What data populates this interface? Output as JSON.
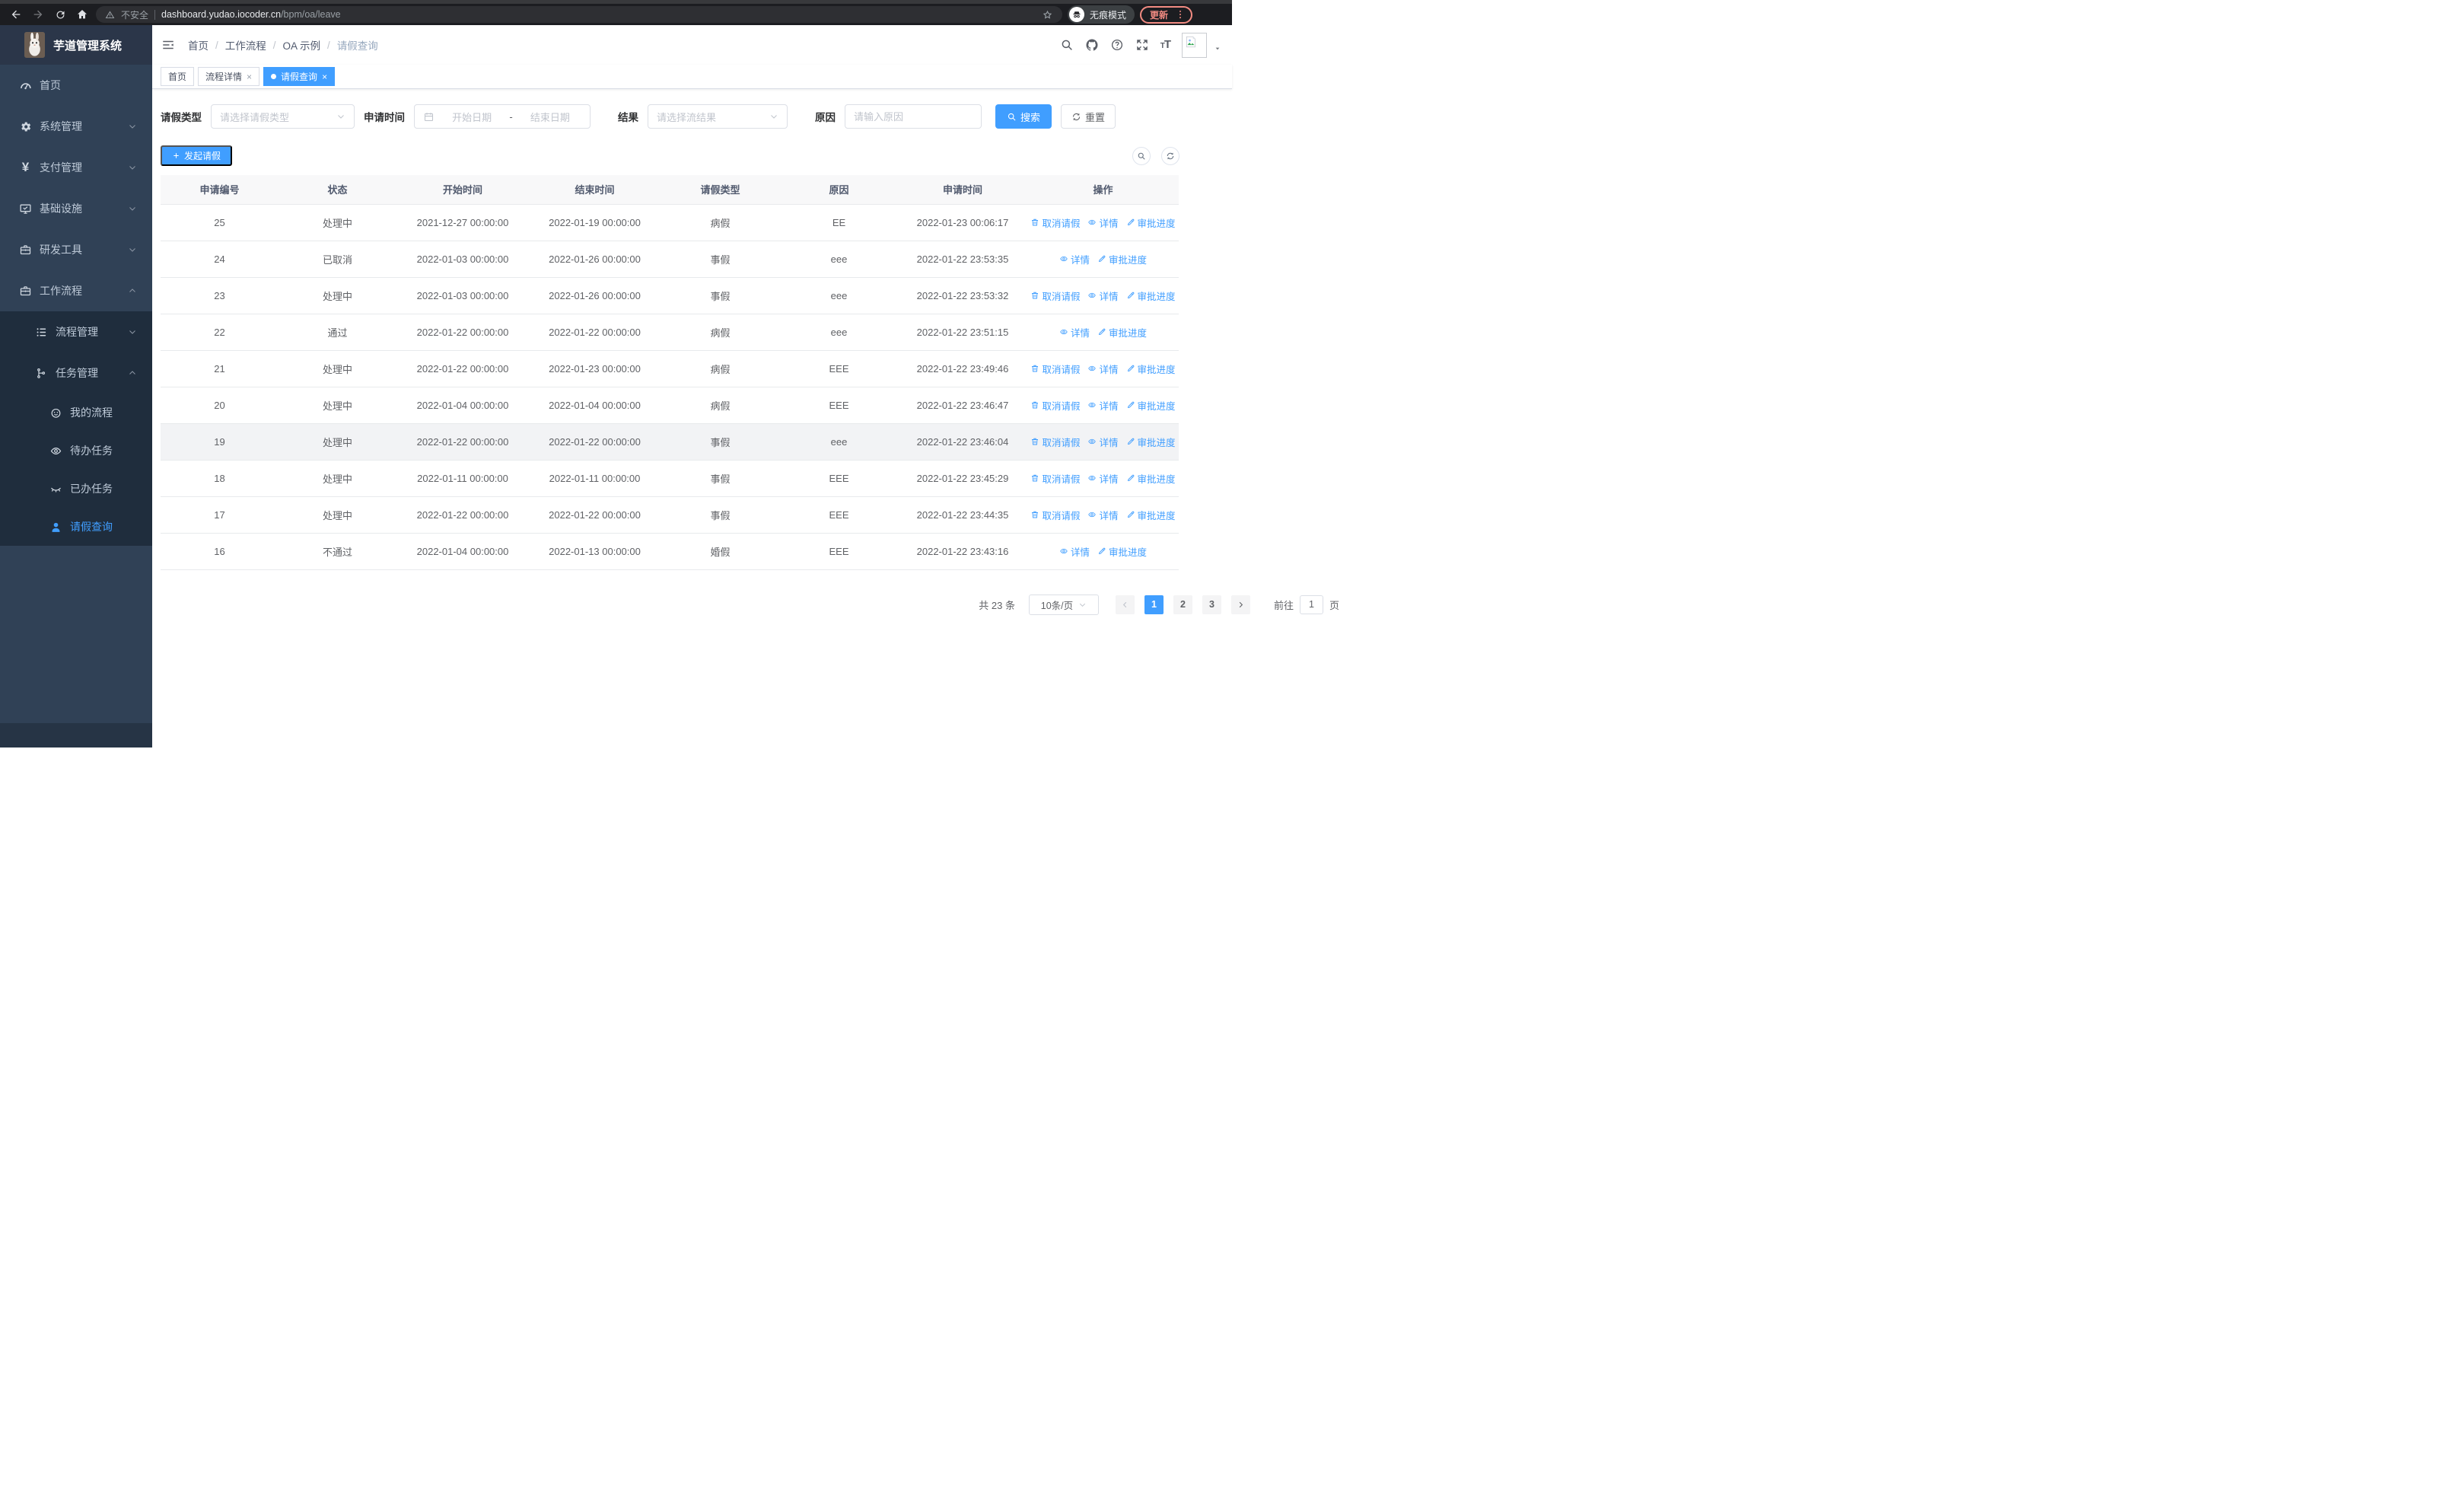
{
  "browser": {
    "security_label": "不安全",
    "url_host": "dashboard.yudao.iocoder.cn",
    "url_path": "/bpm/oa/leave",
    "incognito_label": "无痕模式",
    "update_label": "更新"
  },
  "header": {
    "app_title": "芋道管理系统",
    "breadcrumb": [
      "首页",
      "工作流程",
      "OA 示例",
      "请假查询"
    ],
    "breadcrumb_separator": "/",
    "icons": [
      "search-icon",
      "github-icon",
      "help-icon",
      "fullscreen-icon",
      "font-size-icon",
      "avatar-image",
      "caret-down-icon"
    ]
  },
  "tabs": [
    {
      "label": "首页",
      "closable": false,
      "active": false
    },
    {
      "label": "流程详情",
      "closable": true,
      "active": false
    },
    {
      "label": "请假查询",
      "closable": true,
      "active": true
    }
  ],
  "sidebar": {
    "items": [
      {
        "label": "首页",
        "icon": "dashboard-icon"
      },
      {
        "label": "系统管理",
        "icon": "gear-icon",
        "chevron": "down"
      },
      {
        "label": "支付管理",
        "icon": "yen-icon",
        "chevron": "down"
      },
      {
        "label": "基础设施",
        "icon": "monitor-icon",
        "chevron": "down"
      },
      {
        "label": "研发工具",
        "icon": "toolbox-icon",
        "chevron": "down"
      },
      {
        "label": "工作流程",
        "icon": "briefcase-icon",
        "chevron": "up"
      },
      {
        "label": "流程管理",
        "icon": "list-icon",
        "chevron": "down",
        "nested": 1
      },
      {
        "label": "任务管理",
        "icon": "tree-icon",
        "chevron": "up",
        "nested": 1
      },
      {
        "label": "我的流程",
        "icon": "robot-icon",
        "nested": 2
      },
      {
        "label": "待办任务",
        "icon": "eye-icon",
        "nested": 2
      },
      {
        "label": "已办任务",
        "icon": "eye-closed-icon",
        "nested": 2
      },
      {
        "label": "请假查询",
        "icon": "user-icon",
        "nested": 2,
        "active": true
      }
    ]
  },
  "filters": {
    "leave_type": {
      "label": "请假类型",
      "placeholder": "请选择请假类型"
    },
    "apply_time": {
      "label": "申请时间",
      "start_placeholder": "开始日期",
      "separator": "-",
      "end_placeholder": "结束日期"
    },
    "result": {
      "label": "结果",
      "placeholder": "请选择流结果"
    },
    "reason": {
      "label": "原因",
      "placeholder": "请输入原因"
    },
    "search_label": "搜索",
    "reset_label": "重置"
  },
  "toolbar": {
    "create_label": "发起请假"
  },
  "table": {
    "columns": [
      "申请编号",
      "状态",
      "开始时间",
      "结束时间",
      "请假类型",
      "原因",
      "申请时间",
      "操作"
    ],
    "actions": {
      "cancel": "取消请假",
      "detail": "详情",
      "progress": "审批进度"
    },
    "rows": [
      {
        "id": "25",
        "status": "处理中",
        "start": "2021-12-27 00:00:00",
        "end": "2022-01-19 00:00:00",
        "type": "病假",
        "reason": "EE",
        "applied": "2022-01-23 00:06:17",
        "cancel": true
      },
      {
        "id": "24",
        "status": "已取消",
        "start": "2022-01-03 00:00:00",
        "end": "2022-01-26 00:00:00",
        "type": "事假",
        "reason": "eee",
        "applied": "2022-01-22 23:53:35",
        "cancel": false
      },
      {
        "id": "23",
        "status": "处理中",
        "start": "2022-01-03 00:00:00",
        "end": "2022-01-26 00:00:00",
        "type": "事假",
        "reason": "eee",
        "applied": "2022-01-22 23:53:32",
        "cancel": true
      },
      {
        "id": "22",
        "status": "通过",
        "start": "2022-01-22 00:00:00",
        "end": "2022-01-22 00:00:00",
        "type": "病假",
        "reason": "eee",
        "applied": "2022-01-22 23:51:15",
        "cancel": false
      },
      {
        "id": "21",
        "status": "处理中",
        "start": "2022-01-22 00:00:00",
        "end": "2022-01-23 00:00:00",
        "type": "病假",
        "reason": "EEE",
        "applied": "2022-01-22 23:49:46",
        "cancel": true
      },
      {
        "id": "20",
        "status": "处理中",
        "start": "2022-01-04 00:00:00",
        "end": "2022-01-04 00:00:00",
        "type": "病假",
        "reason": "EEE",
        "applied": "2022-01-22 23:46:47",
        "cancel": true
      },
      {
        "id": "19",
        "status": "处理中",
        "start": "2022-01-22 00:00:00",
        "end": "2022-01-22 00:00:00",
        "type": "事假",
        "reason": "eee",
        "applied": "2022-01-22 23:46:04",
        "cancel": true,
        "hover": true
      },
      {
        "id": "18",
        "status": "处理中",
        "start": "2022-01-11 00:00:00",
        "end": "2022-01-11 00:00:00",
        "type": "事假",
        "reason": "EEE",
        "applied": "2022-01-22 23:45:29",
        "cancel": true
      },
      {
        "id": "17",
        "status": "处理中",
        "start": "2022-01-22 00:00:00",
        "end": "2022-01-22 00:00:00",
        "type": "事假",
        "reason": "EEE",
        "applied": "2022-01-22 23:44:35",
        "cancel": true
      },
      {
        "id": "16",
        "status": "不通过",
        "start": "2022-01-04 00:00:00",
        "end": "2022-01-13 00:00:00",
        "type": "婚假",
        "reason": "EEE",
        "applied": "2022-01-22 23:43:16",
        "cancel": false
      }
    ]
  },
  "pagination": {
    "total_label": "共 23 条",
    "page_size_label": "10条/页",
    "pages": [
      "1",
      "2",
      "3"
    ],
    "active_page": "1",
    "goto_label": "前往",
    "goto_value": "1",
    "unit_label": "页"
  },
  "colors": {
    "accent": "#409eff",
    "sidebar_bg": "#304156",
    "sidebar_sub_bg": "#1f2d3d",
    "link": "#409eff",
    "update_badge": "#f28b82",
    "table_header_bg": "#f8f8f9"
  }
}
